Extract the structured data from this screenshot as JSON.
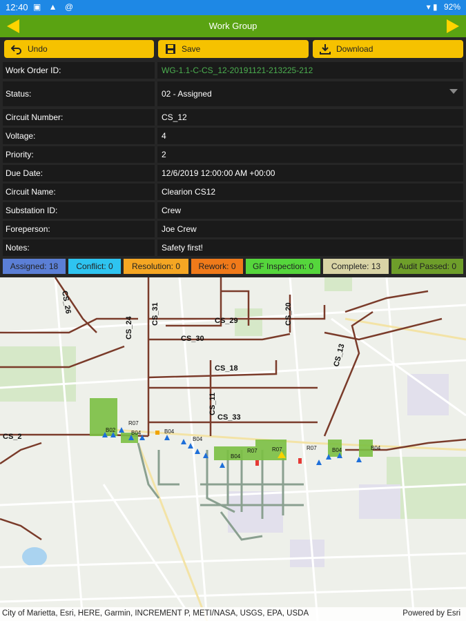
{
  "statusbar": {
    "time": "12:40",
    "icons": "▣ ▲ @",
    "signal": "▾ ▮",
    "battery": "92%"
  },
  "header": {
    "title": "Work Group"
  },
  "toolbar": {
    "undo_label": "Undo",
    "save_label": "Save",
    "download_label": "Download"
  },
  "fields": [
    {
      "label": "Work Order ID:",
      "value": "WG-1.1-C-CS_12-20191121-213225-212"
    },
    {
      "label": "Status:",
      "value": "02 - Assigned"
    },
    {
      "label": "Circuit Number:",
      "value": "CS_12"
    },
    {
      "label": "Voltage:",
      "value": "4"
    },
    {
      "label": "Priority:",
      "value": "2"
    },
    {
      "label": "Due Date:",
      "value": "12/6/2019 12:00:00 AM +00:00"
    },
    {
      "label": "Circuit Name:",
      "value": "Clearion CS12"
    },
    {
      "label": "Substation ID:",
      "value": "Crew"
    },
    {
      "label": "Foreperson:",
      "value": "Joe Crew"
    },
    {
      "label": "Notes:",
      "value": "Safety first!"
    }
  ],
  "badges": [
    {
      "label": "Assigned: 18",
      "color": "#5b7fd6"
    },
    {
      "label": "Conflict: 0",
      "color": "#2ec4f0"
    },
    {
      "label": "Resolution: 0",
      "color": "#f5a623"
    },
    {
      "label": "Rework: 0",
      "color": "#f07a1a"
    },
    {
      "label": "GF Inspection: 0",
      "color": "#55d63c"
    },
    {
      "label": "Complete: 13",
      "color": "#d9d4a6"
    },
    {
      "label": "Audit Passed: 0",
      "color": "#6e9e2a"
    }
  ],
  "map": {
    "circuit_labels": [
      "CS_26",
      "CS_24",
      "CS_31",
      "CS_20",
      "CS_29",
      "CS_30",
      "CS_18",
      "CS_13",
      "CS_11",
      "CS_33",
      "CS_2"
    ],
    "segment_labels": [
      "R07",
      "B04",
      "B02",
      "B04",
      "B04",
      "B04",
      "R07",
      "R07",
      "R07",
      "B04",
      "B04"
    ],
    "attribution": "City of Marietta, Esri, HERE, Garmin, INCREMENT P, METI/NASA, USGS, EPA, USDA",
    "powered_by": "Powered by Esri"
  }
}
